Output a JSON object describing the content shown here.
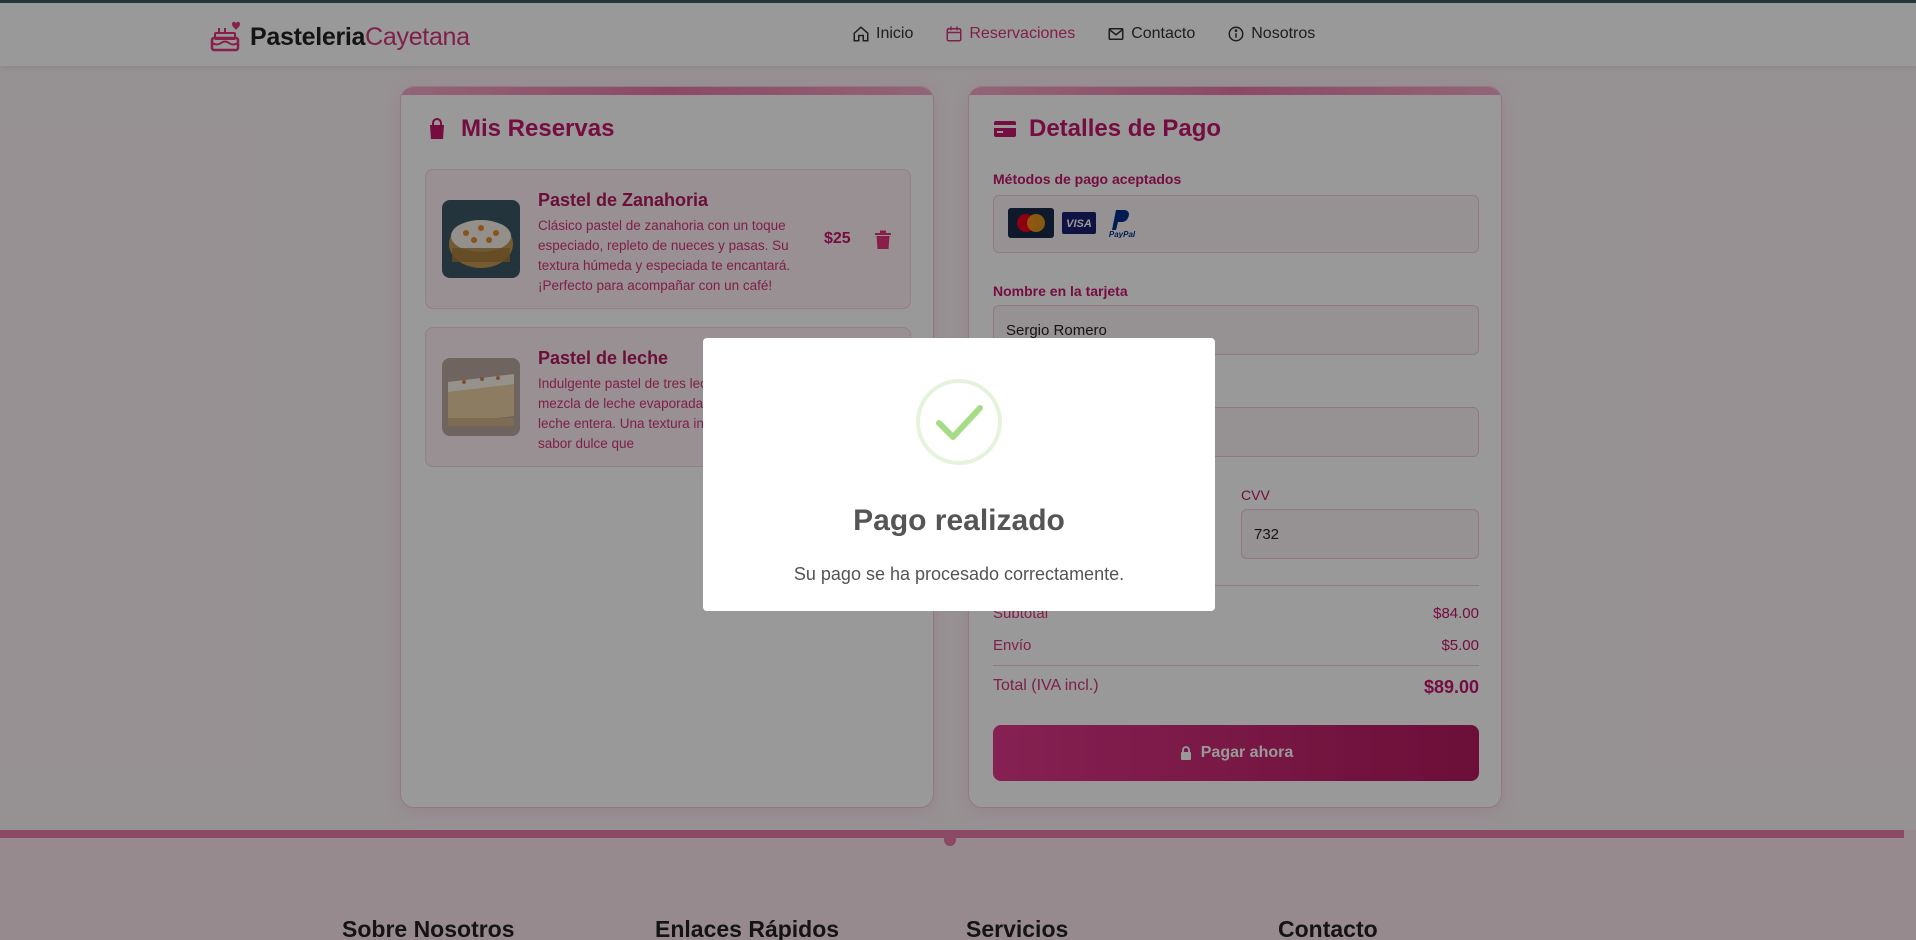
{
  "brand": {
    "name_strong": "Pasteleria",
    "name_light": "Cayetana",
    "icon": "cake-heart-icon"
  },
  "nav": [
    {
      "label": "Inicio",
      "icon": "home-icon",
      "active": false
    },
    {
      "label": "Reservaciones",
      "icon": "calendar-icon",
      "active": true
    },
    {
      "label": "Contacto",
      "icon": "mail-icon",
      "active": false
    },
    {
      "label": "Nosotros",
      "icon": "info-icon",
      "active": false
    }
  ],
  "reservations": {
    "title": "Mis Reservas",
    "icon": "shopping-bag-icon",
    "items": [
      {
        "name": "Pastel de Zanahoria",
        "description": "Clásico pastel de zanahoria con un toque especiado, repleto de nueces y pasas. Su textura húmeda y especiada te encantará. ¡Perfecto para acompañar con un café!",
        "price": "$25"
      },
      {
        "name": "Pastel de leche",
        "description": "Indulgente pastel de tres leches con una mezcla de leche evaporada, condensada y leche entera. Una textura increíble y un sabor dulce que"
      }
    ]
  },
  "payment": {
    "title": "Detalles de Pago",
    "icon": "credit-card-icon",
    "methods_label": "Métodos de pago aceptados",
    "methods": [
      "MasterCard",
      "VISA",
      "PayPal"
    ],
    "name_label": "Nombre en la tarjeta",
    "name_value": "Sergio Romero",
    "cvv_label": "CVV",
    "cvv_value": "732",
    "subtotal_label": "Subtotal",
    "subtotal_value": "$84.00",
    "shipping_label": "Envío",
    "shipping_value": "$5.00",
    "total_label": "Total (IVA incl.)",
    "total_value": "$89.00",
    "pay_button": "Pagar ahora"
  },
  "footer": {
    "columns": [
      "Sobre Nosotros",
      "Enlaces Rápidos",
      "Servicios",
      "Contacto"
    ]
  },
  "modal": {
    "title": "Pago realizado",
    "text": "Su pago se ha procesado correctamente.",
    "icon": "check-icon"
  },
  "colors": {
    "accent": "#d6357a",
    "accent_dark": "#b3195e"
  }
}
